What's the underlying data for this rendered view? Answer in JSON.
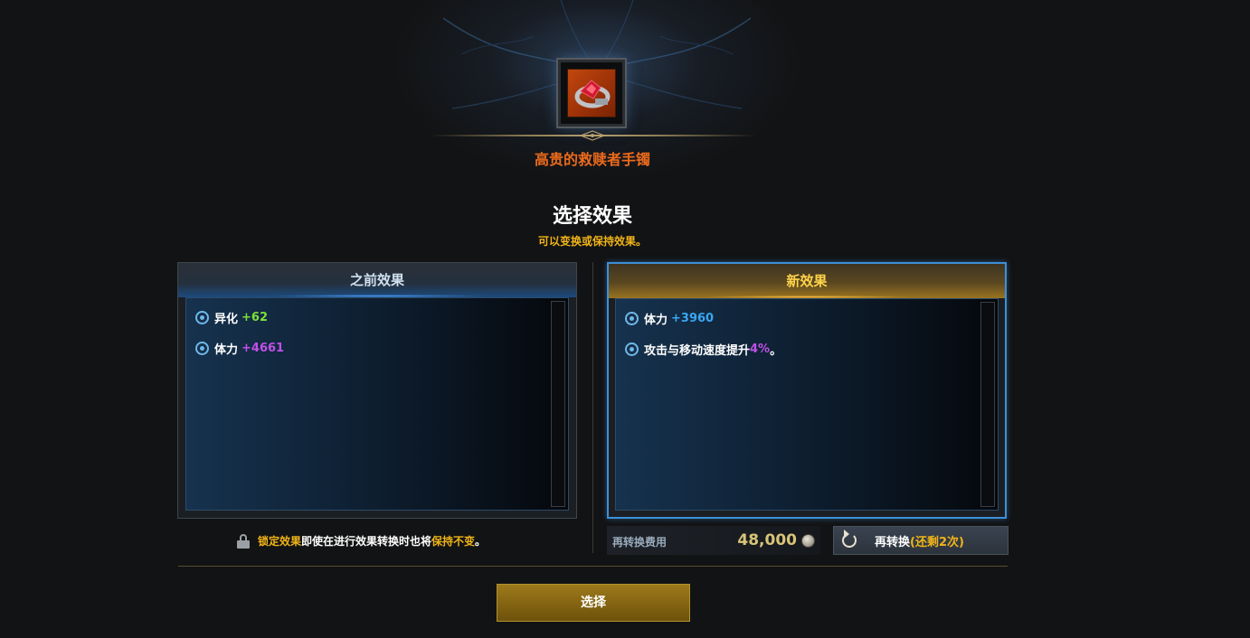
{
  "item": {
    "name": "高贵的救赎者手镯"
  },
  "header": {
    "title": "选择效果",
    "subtitle": "可以变换或保持效果。"
  },
  "before_panel": {
    "title": "之前效果",
    "effects": [
      {
        "label": "异化",
        "value": "+62"
      },
      {
        "label": "体力",
        "value": "+4661"
      }
    ]
  },
  "after_panel": {
    "title": "新效果",
    "effects": [
      {
        "label": "体力",
        "value": "+3960"
      },
      {
        "label": "攻击与移动速度提升",
        "value": "4%",
        "suffix": "。"
      }
    ]
  },
  "lock_note": {
    "part1": "锁定效果",
    "part2": "即使在进行效果转换时也将",
    "part3": "保持不变",
    "part4": "。"
  },
  "cost": {
    "label": "再转换费用",
    "amount": "48,000"
  },
  "reroll": {
    "label": "再转换",
    "remaining": "(还剩2次)"
  },
  "select_button": {
    "label": "选择"
  },
  "colors": {
    "item_name": "#ec6a1c",
    "accent_yellow": "#f0b418",
    "selected_border": "#3d8fd8",
    "value_green": "#7de03c",
    "value_purple": "#c050e8",
    "value_blue": "#3aa6f2"
  }
}
